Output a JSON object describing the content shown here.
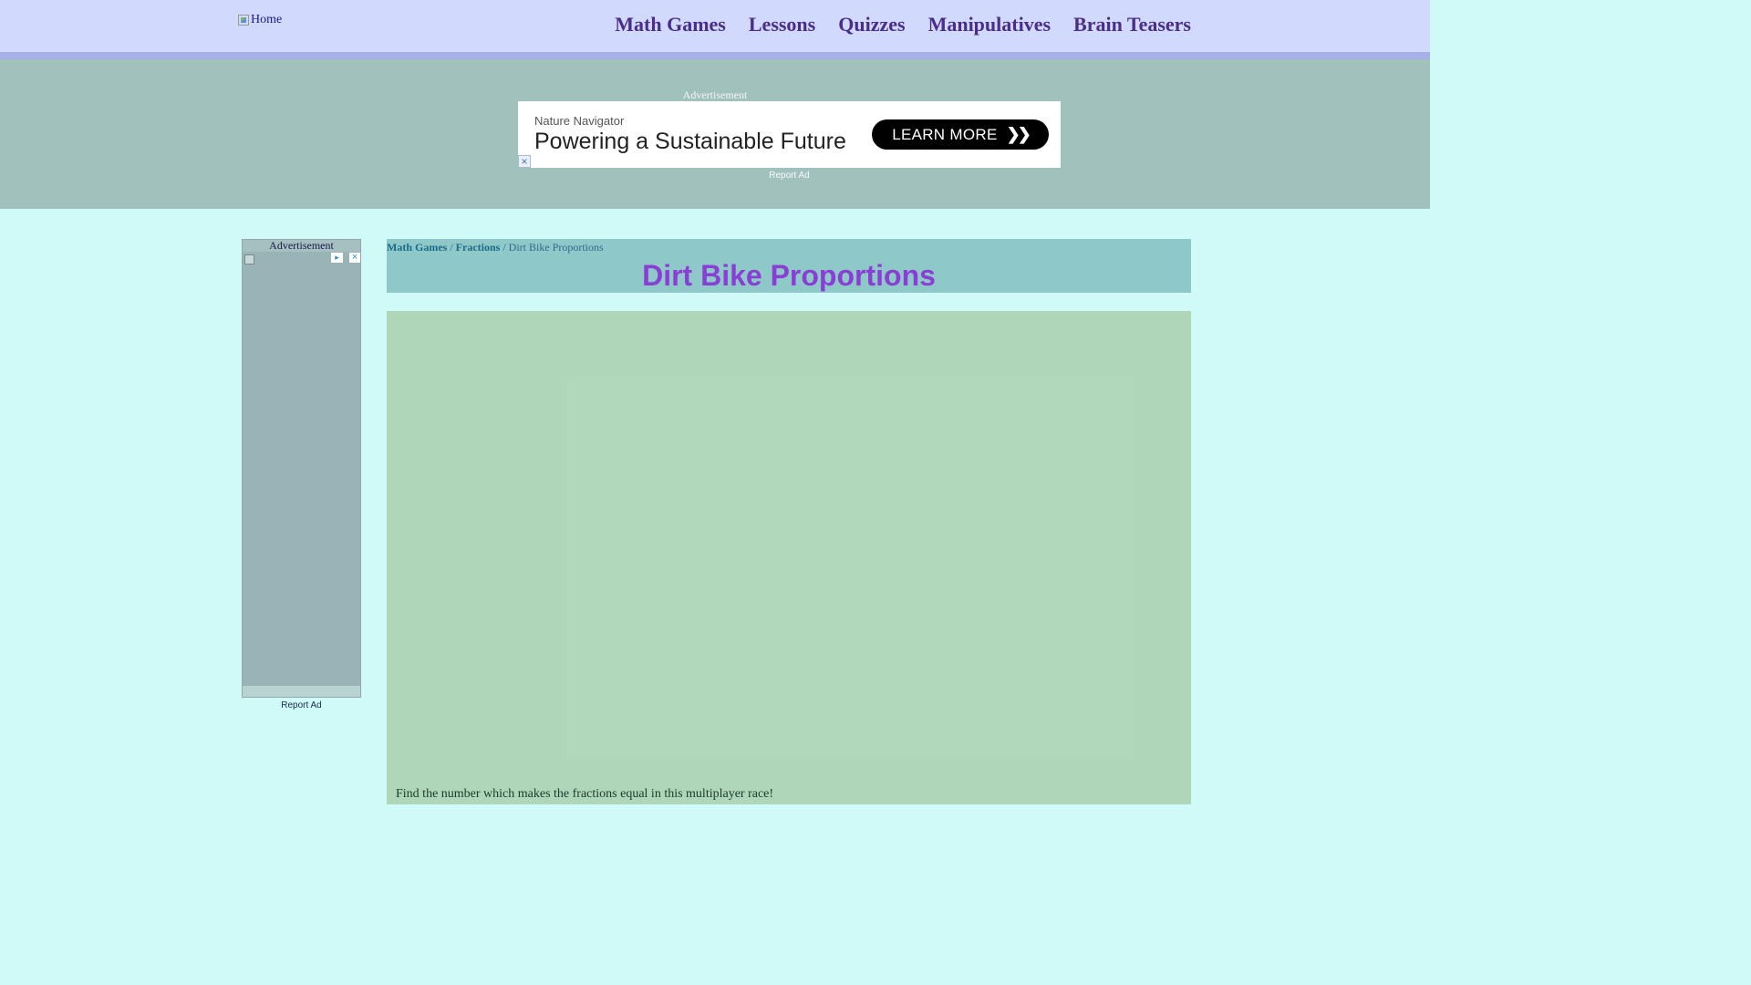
{
  "header": {
    "home_alt": "Home",
    "nav": [
      {
        "label": "Math Games"
      },
      {
        "label": "Lessons"
      },
      {
        "label": "Quizzes"
      },
      {
        "label": "Manipulatives"
      },
      {
        "label": "Brain Teasers"
      }
    ]
  },
  "top_ad": {
    "label": "Advertisement",
    "advertiser": "Nature Navigator",
    "headline": "Powering a Sustainable Future",
    "cta": "LEARN MORE",
    "cta_icon": "double-chevron-right-icon",
    "close_symbol": "×",
    "report": "Report Ad"
  },
  "side_ad": {
    "label": "Advertisement",
    "choices_symbol": "▸",
    "close_symbol": "×",
    "report": "Report Ad"
  },
  "breadcrumb": {
    "items": [
      "Math Games",
      "Fractions"
    ],
    "separator": " / ",
    "current": "Dirt Bike Proportions"
  },
  "page": {
    "title": "Dirt Bike Proportions",
    "description": "Find the number which makes the fractions equal in this multiplayer race!"
  },
  "colors": {
    "header_bg": "#d1d9fc",
    "nav_text": "#4a2e8a",
    "page_bg": "#cffaf8",
    "ad_band": "#a1c1bc",
    "title_text": "#8a3fd4",
    "game_bg": "#b0d6ba"
  }
}
